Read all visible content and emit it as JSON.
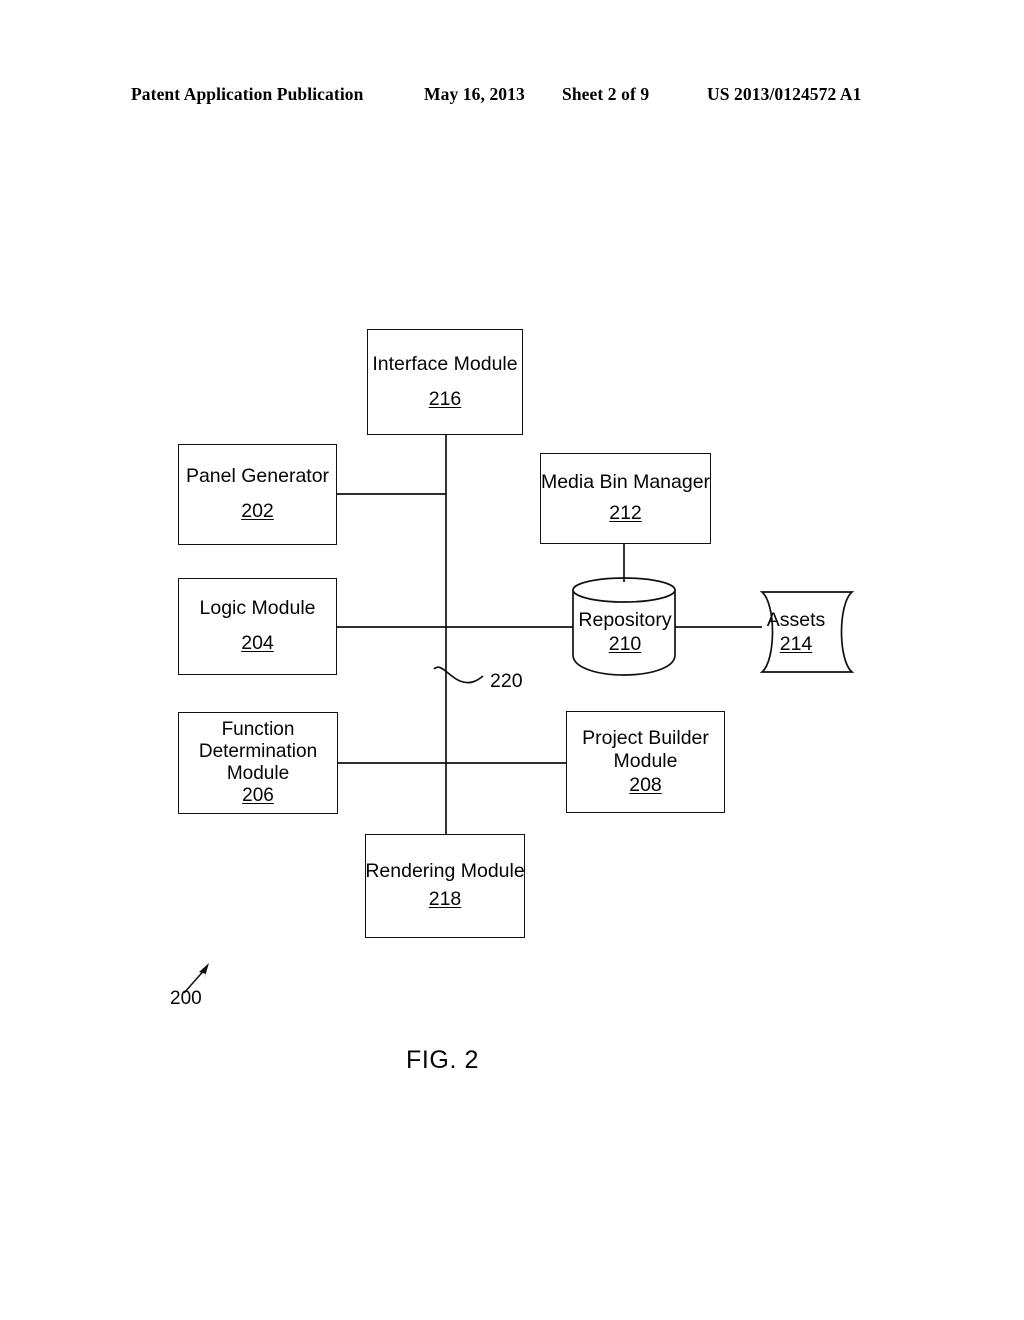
{
  "header": {
    "publication": "Patent Application Publication",
    "date": "May 16, 2013",
    "sheet": "Sheet 2 of 9",
    "document_number": "US 2013/0124572 A1"
  },
  "figure": {
    "caption": "FIG. 2",
    "system_ref": "200",
    "bus_ref": "220",
    "nodes": {
      "interface": {
        "label": "Interface Module",
        "ref": "216"
      },
      "panel_generator": {
        "label": "Panel Generator",
        "ref": "202"
      },
      "media_bin_manager": {
        "label": "Media Bin Manager",
        "ref": "212"
      },
      "logic": {
        "label": "Logic Module",
        "ref": "204"
      },
      "repository": {
        "label": "Repository",
        "ref": "210"
      },
      "assets": {
        "label": "Assets",
        "ref": "214"
      },
      "function_determination": {
        "line1": "Function",
        "line2": "Determination",
        "line3": "Module",
        "ref": "206"
      },
      "project_builder": {
        "line1": "Project Builder",
        "line2": "Module",
        "ref": "208"
      },
      "rendering": {
        "label": "Rendering Module",
        "ref": "218"
      }
    }
  }
}
